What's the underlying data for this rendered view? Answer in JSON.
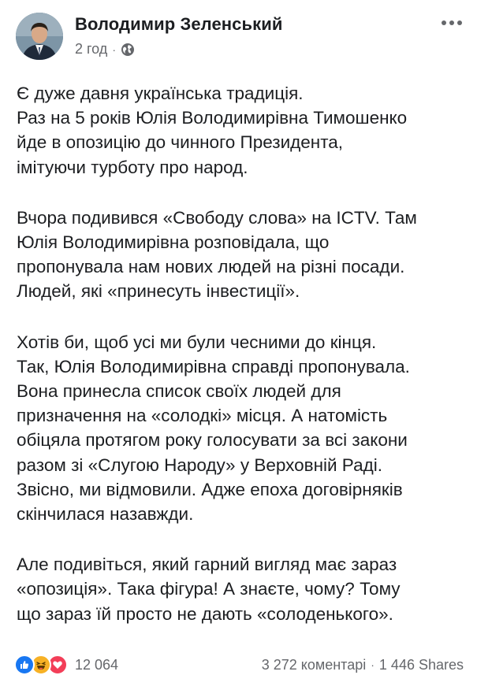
{
  "post": {
    "author": "Володимир Зеленський",
    "time": "2 год",
    "separator": "·",
    "privacy_icon": "globe-icon",
    "more_icon": "more-options-icon",
    "paragraphs": [
      [
        "Є дуже давня українська традиція.",
        "Раз на 5 років Юлія Володимирівна Тимошенко",
        "йде в опозицію до чинного Президента,",
        "імітуючи турботу про народ."
      ],
      [
        "Вчора подивився «Свободу слова» на ICTV. Там",
        "Юлія Володимирівна розповідала, що",
        "пропонувала нам нових людей на різні посади.",
        "Людей, які «принесуть інвестиції»."
      ],
      [
        "Хотів би, щоб усі ми були чесними до кінця.",
        "Так, Юлія Володимирівна справді пропонувала.",
        "Вона принесла список своїх людей для",
        "призначення на «солодкі» місця. А натомість",
        "обіцяла протягом року голосувати за всі закони",
        "разом зі «Слугою Народу» у Верховній Раді.",
        "Звісно, ми відмовили. Адже епоха договірняків",
        "скінчилася назавжди."
      ],
      [
        "Але подивіться, який гарний вигляд має зараз",
        "«опозиція». Така фігура! А знаєте, чому? Тому",
        "що зараз їй просто не дають «солоденького»."
      ]
    ]
  },
  "footer": {
    "reactions": [
      "like",
      "haha",
      "love"
    ],
    "reaction_colors": {
      "like": "#1877f2",
      "haha": "#f7b125",
      "love": "#f33e58"
    },
    "reaction_count": "12 064",
    "comments": "3 272 коментарі",
    "separator": "·",
    "shares": "1 446 Shares"
  }
}
